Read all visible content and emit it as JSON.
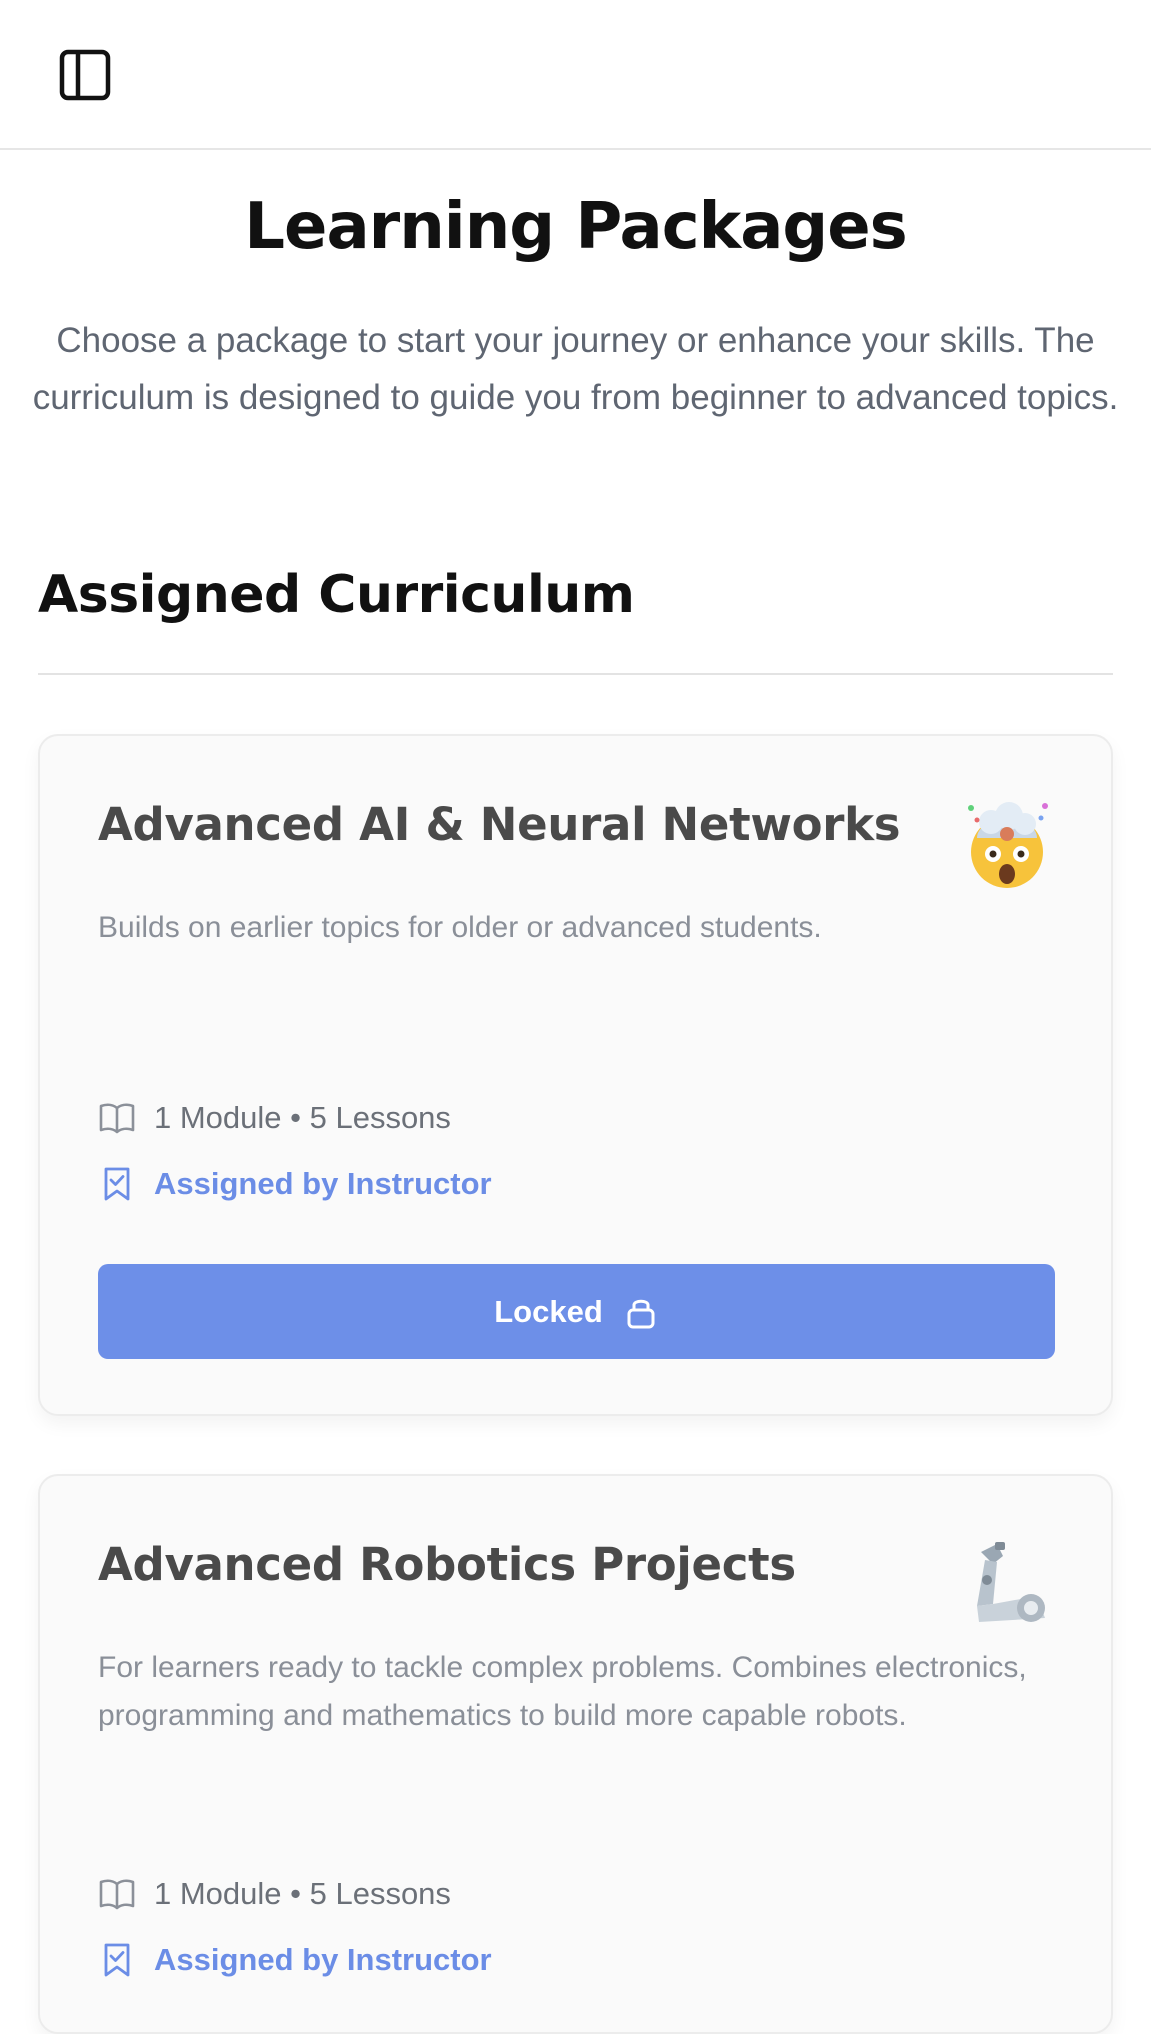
{
  "topbar": {
    "toggle_icon": "sidebar-toggle-icon"
  },
  "header": {
    "title": "Learning Packages",
    "subtitle": "Choose a package to start your journey or enhance your skills. The curriculum is designed to guide you from beginner to advanced topics."
  },
  "section": {
    "title": "Assigned Curriculum"
  },
  "cards": [
    {
      "title": "Advanced AI & Neural Networks",
      "emoji": "exploding-head-icon",
      "description": "Builds on earlier topics for older or advanced students.",
      "meta": "1 Module • 5 Lessons",
      "assigned": "Assigned by Instructor",
      "button_label": "Locked"
    },
    {
      "title": "Advanced Robotics Projects",
      "emoji": "mechanical-arm-icon",
      "description": "For learners ready to tackle complex problems. Combines electronics, programming and mathematics to build more capable robots.",
      "meta": "1 Module • 5 Lessons",
      "assigned": "Assigned by Instructor"
    }
  ],
  "colors": {
    "accent": "#6d8fe8",
    "assigned_text": "#6b8de6",
    "card_title": "#4a4a4a",
    "muted_text": "#8a8f98"
  }
}
